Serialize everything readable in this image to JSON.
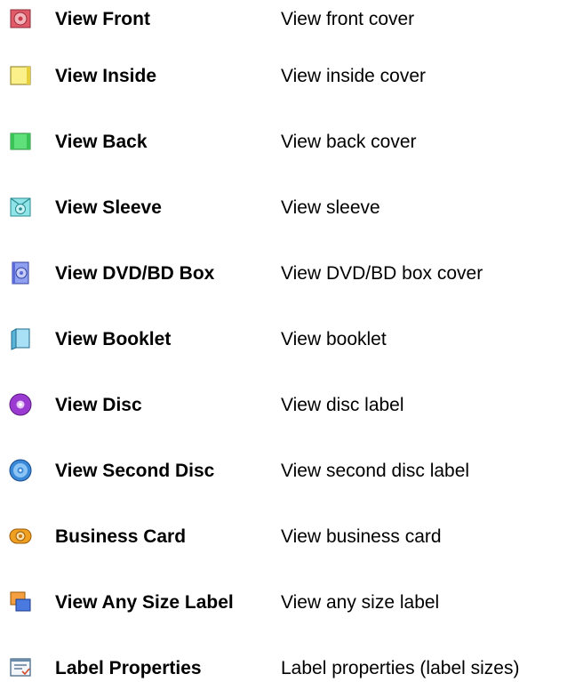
{
  "items": [
    {
      "label": "View Front",
      "description": "View front cover",
      "icon": "front-cover-icon"
    },
    {
      "label": "View Inside",
      "description": "View inside cover",
      "icon": "inside-cover-icon"
    },
    {
      "label": "View Back",
      "description": "View back cover",
      "icon": "back-cover-icon"
    },
    {
      "label": "View Sleeve",
      "description": "View sleeve",
      "icon": "sleeve-icon"
    },
    {
      "label": "View DVD/BD Box",
      "description": "View DVD/BD box cover",
      "icon": "dvd-box-icon"
    },
    {
      "label": "View Booklet",
      "description": "View booklet",
      "icon": "booklet-icon"
    },
    {
      "label": "View Disc",
      "description": "View disc label",
      "icon": "disc-icon"
    },
    {
      "label": "View Second Disc",
      "description": "View second disc label",
      "icon": "second-disc-icon"
    },
    {
      "label": "Business Card",
      "description": "View business card",
      "icon": "business-card-icon"
    },
    {
      "label": "View Any Size Label",
      "description": "View any size label",
      "icon": "any-size-label-icon"
    },
    {
      "label": "Label Properties",
      "description": "Label properties (label sizes)",
      "icon": "label-properties-icon"
    }
  ]
}
